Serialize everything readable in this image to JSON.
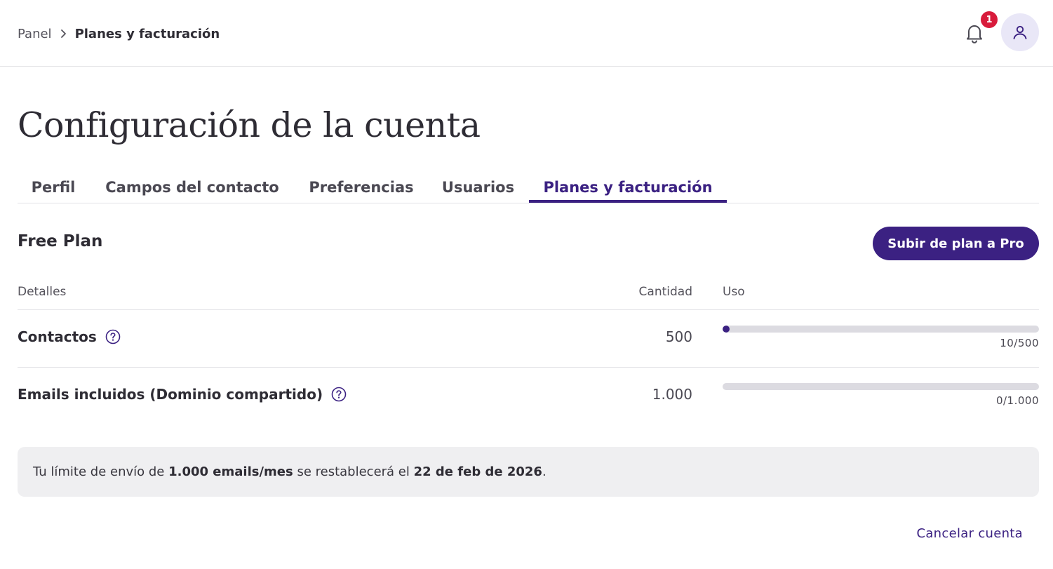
{
  "breadcrumb": {
    "root": "Panel",
    "current": "Planes y facturación"
  },
  "header": {
    "notifications_count": "1",
    "icons": [
      "bell-icon",
      "user-icon"
    ]
  },
  "page": {
    "title": "Configuración de la cuenta"
  },
  "tabs": [
    {
      "label": "Perfil",
      "active": false
    },
    {
      "label": "Campos del contacto",
      "active": false
    },
    {
      "label": "Preferencias",
      "active": false
    },
    {
      "label": "Usuarios",
      "active": false
    },
    {
      "label": "Planes y facturación",
      "active": true
    }
  ],
  "plan": {
    "name": "Free Plan",
    "upgrade_label": "Subir de plan a Pro"
  },
  "table": {
    "headers": {
      "details": "Detalles",
      "quantity": "Cantidad",
      "usage": "Uso"
    },
    "rows": [
      {
        "label": "Contactos",
        "quantity": "500",
        "usage_text": "10/500",
        "usage_fraction": 0.02
      },
      {
        "label": "Emails incluidos (Dominio compartido)",
        "quantity": "1.000",
        "usage_text": "0/1.000",
        "usage_fraction": 0
      }
    ]
  },
  "notice": {
    "prefix": "Tu límite de envío de ",
    "limit": "1.000 emails/mes",
    "middle": " se restablecerá el ",
    "date": "22 de feb de 2026",
    "suffix": "."
  },
  "footer": {
    "cancel_label": "Cancelar cuenta"
  },
  "colors": {
    "accent": "#3b2182",
    "badge": "#d81b3b",
    "bar_track": "#dcdbe1",
    "notice_bg": "#efeff1"
  }
}
